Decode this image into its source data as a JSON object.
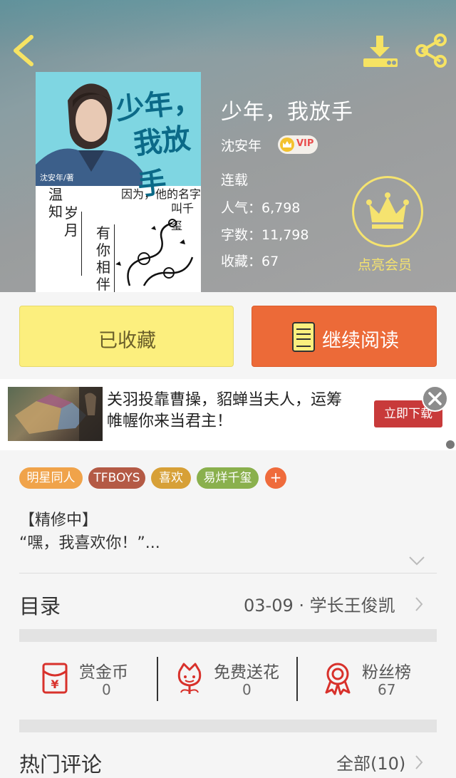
{
  "header": {
    "book_title": "少年，我放手",
    "author": "沈安年",
    "vip_label": "VIP",
    "status": "连载",
    "popularity": "人气：6,798",
    "word_count": "字数：11,798",
    "favorites": "收藏：67",
    "member_label": "点亮会员"
  },
  "cover": {
    "title_line1": "少年，",
    "title_line2": "我放手",
    "author_tag": "沈安年/著",
    "sub_line1": "因为，他的名字",
    "sub_line2": "叫千玺",
    "vertical1": "温知",
    "vertical2": "岁月",
    "vertical3": "有你相伴"
  },
  "buttons": {
    "favorited": "已收藏",
    "continue_reading": "继续阅读"
  },
  "ad": {
    "text": "关羽投靠曹操，貂蝉当夫人，运筹帷幄你来当君主！",
    "cta": "立即下载"
  },
  "tags": [
    "明星同人",
    "TFBOYS",
    "喜欢",
    "易烊千玺"
  ],
  "tag_add": "+",
  "intro": {
    "tag": "【精修中】",
    "text": "“嘿，我喜欢你！”..."
  },
  "toc": {
    "label": "目录",
    "latest": "03-09 · 学长王俊凯"
  },
  "actions": [
    {
      "label": "赏金币",
      "count": "0",
      "icon": "coin-envelope-icon"
    },
    {
      "label": "免费送花",
      "count": "0",
      "icon": "flower-icon"
    },
    {
      "label": "粉丝榜",
      "count": "67",
      "icon": "medal-icon"
    }
  ],
  "comments": {
    "label": "热门评论",
    "all": "全部(10)"
  },
  "colors": {
    "favorite_button": "#fcef7e",
    "read_button": "#ec6a38",
    "member_gold": "#f5e36f",
    "icon_red": "#d8312b"
  }
}
